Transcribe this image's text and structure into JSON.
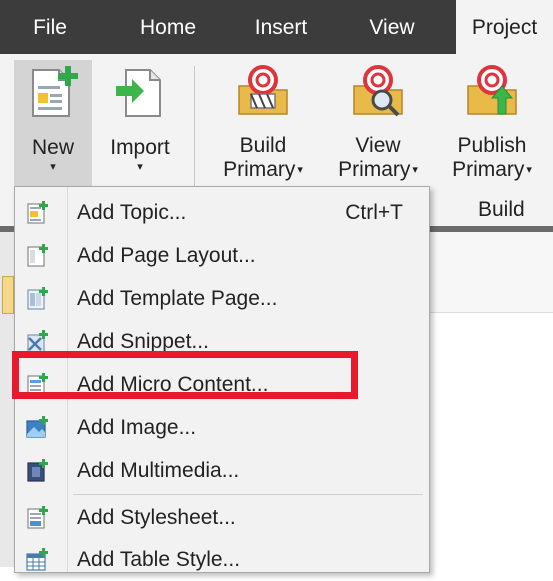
{
  "tabs": [
    {
      "label": "File",
      "active": false
    },
    {
      "label": "Home",
      "active": false
    },
    {
      "label": "Insert",
      "active": false
    },
    {
      "label": "View",
      "active": false
    },
    {
      "label": "Project",
      "active": true
    }
  ],
  "ribbon": {
    "new": {
      "label": "New",
      "caret": "▾"
    },
    "import": {
      "label": "Import",
      "caret": "▾"
    },
    "build_primary": {
      "line1": "Build",
      "line2": "Primary",
      "caret": "▾"
    },
    "view_primary": {
      "line1": "View",
      "line2": "Primary",
      "caret": "▾"
    },
    "publish_primary": {
      "line1": "Publish",
      "line2": "Primary",
      "caret": "▾"
    },
    "group_build": "Build"
  },
  "menu": {
    "items": [
      {
        "label": "Add Topic...",
        "shortcut": "Ctrl+T",
        "icon": "topic-icon"
      },
      {
        "label": "Add Page Layout...",
        "shortcut": "",
        "icon": "page-layout-icon"
      },
      {
        "label": "Add Template Page...",
        "shortcut": "",
        "icon": "template-page-icon"
      },
      {
        "label": "Add Snippet...",
        "shortcut": "",
        "icon": "snippet-icon"
      },
      {
        "label": "Add Micro Content...",
        "shortcut": "",
        "icon": "micro-content-icon"
      },
      {
        "label": "Add Image...",
        "shortcut": "",
        "icon": "image-icon"
      },
      {
        "label": "Add Multimedia...",
        "shortcut": "",
        "icon": "multimedia-icon"
      },
      {
        "label": "Add Stylesheet...",
        "shortcut": "",
        "icon": "stylesheet-icon"
      },
      {
        "label": "Add Table Style...",
        "shortcut": "",
        "icon": "table-style-icon"
      }
    ],
    "highlighted_index": 4
  },
  "colors": {
    "tabbar": "#3c3c3c",
    "ribbon": "#f3f3f3",
    "highlight": "#e8192c"
  }
}
